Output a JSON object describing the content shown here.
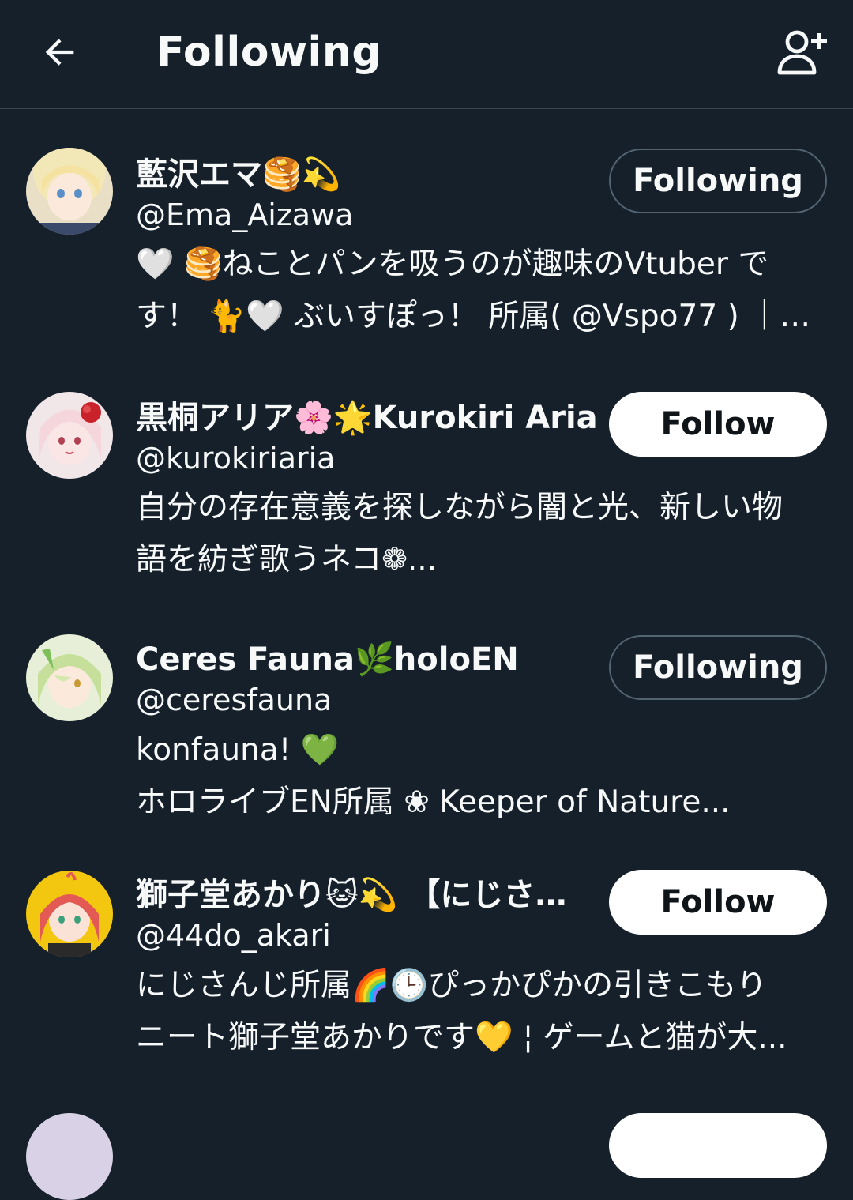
{
  "header": {
    "title": "Following",
    "back_icon": "arrow-left-icon",
    "add_icon": "add-user-icon"
  },
  "colors": {
    "background": "#15202b",
    "divider": "#38444d",
    "text": "#f7f9f9",
    "button_border": "#536471"
  },
  "accounts": [
    {
      "name": "藍沢エマ🥞💫",
      "handle": "@Ema_Aizawa",
      "bio": [
        "🤍 🥞ねことパンを吸うのが趣味のVtuber で",
        "す！ 🐈🤍 ぶいすぽっ！ 所属( @Vspo77 ) ｜マ..."
      ],
      "button": "Following"
    },
    {
      "name": "黒桐アリア🌸🌟Kurokiri Aria",
      "handle": "@kurokiriaria",
      "bio": [
        "自分の存在意義を探しながら闇と光、新しい物",
        "語を紡ぎ歌うネコ❁..."
      ],
      "button": "Follow"
    },
    {
      "name": "Ceres Fauna🌿holoEN",
      "handle": "@ceresfauna",
      "bio": [
        "konfauna! 💚",
        "ホロライブEN所属 ❀ Keeper of Nature..."
      ],
      "button": "Following"
    },
    {
      "name": "獅子堂あかり🐱💫 【にじさ...",
      "handle": "@44do_akari",
      "bio": [
        "にじさんじ所属🌈🕒ぴっかぴかの引きこもり",
        "ニート獅子堂あかりです💛 ¦ ゲームと猫が大..."
      ],
      "button": "Follow"
    }
  ]
}
